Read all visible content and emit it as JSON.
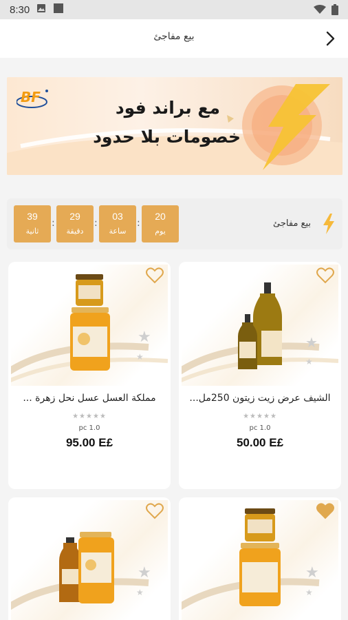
{
  "status_bar": {
    "time": "8:30"
  },
  "app_bar": {
    "title": "بيع مفاجئ"
  },
  "banner": {
    "logo_text": "BF",
    "line1": "مع براند فود",
    "line2": "خصومات بلا حدود"
  },
  "flash_sale": {
    "title": "بيع مفاجئ",
    "countdown": [
      {
        "value": "20",
        "label": "يوم"
      },
      {
        "value": "03",
        "label": "ساعة"
      },
      {
        "value": "29",
        "label": "دقيقة"
      },
      {
        "value": "39",
        "label": "ثانية"
      }
    ]
  },
  "colors": {
    "accent": "#e5aa55",
    "heart_outline": "#e0a84e"
  },
  "products": [
    {
      "name": "الشيف عرض زيت زيتون 250مل...",
      "rating_stars": "★★★★★",
      "unit": "pc 1.0",
      "price": "50.00 E£",
      "favorite": false
    },
    {
      "name": "مملكة العسل عسل نحل زهرة ...",
      "rating_stars": "★★★★★",
      "unit": "pc 1.0",
      "price": "95.00 E£",
      "favorite": false
    },
    {
      "name": "",
      "rating_stars": "",
      "unit": "",
      "price": "",
      "favorite": true
    },
    {
      "name": "",
      "rating_stars": "",
      "unit": "",
      "price": "",
      "favorite": false
    }
  ]
}
